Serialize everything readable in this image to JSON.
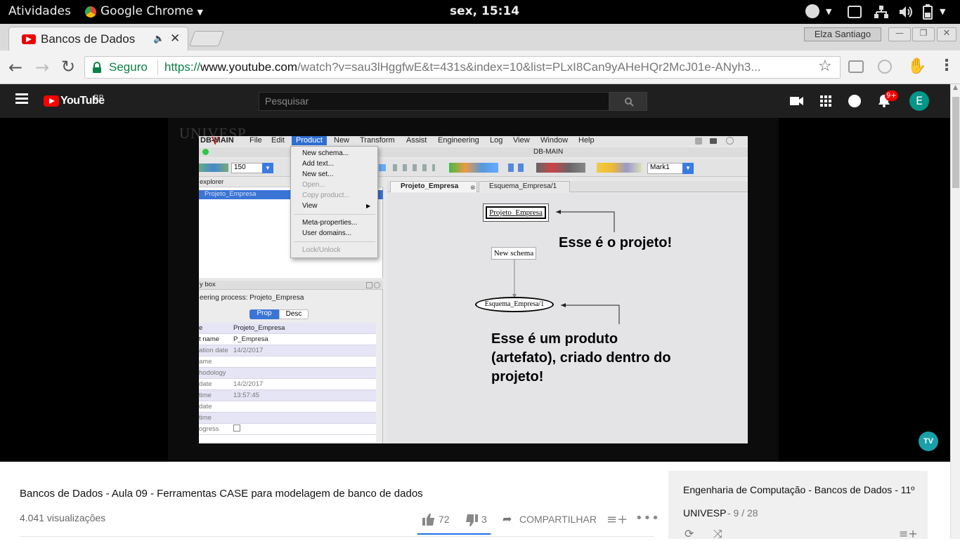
{
  "gnome": {
    "activities": "Atividades",
    "app_name": "Google Chrome",
    "clock": "sex, 15:14"
  },
  "chrome": {
    "tab_title": "Bancos de Dados",
    "profile_name": "Elza Santiago",
    "secure_label": "Seguro",
    "url_scheme": "https://",
    "url_host": "www.youtube.com",
    "url_rest": "/watch?v=sau3lHggfwE&t=431s&index=10&list=PLxI8Can9yAHeHQr2McJ01e-ANyh3..."
  },
  "youtube": {
    "logo_text": "YouTube",
    "region": "BR",
    "search_placeholder": "Pesquisar",
    "notif_count": "9+",
    "avatar_letter": "E"
  },
  "slide": {
    "watermark": "UNIVESP",
    "menubar": [
      "DB-MAIN",
      "File",
      "Edit",
      "Product",
      "New",
      "Transform",
      "Assist",
      "Engineering",
      "Log",
      "View",
      "Window",
      "Help"
    ],
    "window_title": "DB-MAIN",
    "zoom": "150",
    "mark": "Mark1",
    "dropdown": [
      "New schema...",
      "Add text...",
      "New set...",
      "Open...",
      "Copy product...",
      "View",
      "Meta-properties...",
      "User domains...",
      "Lock/Unlock"
    ],
    "explorer_title": "explorer",
    "explorer_item": "Projeto_Empresa",
    "propbox_title": "y box",
    "propbox_process": "eering process: Projeto_Empresa",
    "prop_tab": "Prop",
    "desc_tab": "Desc",
    "props": [
      {
        "k": "e",
        "v": "Projeto_Empresa"
      },
      {
        "k": "t name",
        "v": "P_Empresa"
      },
      {
        "k": "ation date",
        "v": "14/2/2017"
      },
      {
        "k": "ame",
        "v": ""
      },
      {
        "k": "hodology",
        "v": ""
      },
      {
        "k": "date",
        "v": "14/2/2017"
      },
      {
        "k": "time",
        "v": "13:57:45"
      },
      {
        "k": "date",
        "v": ""
      },
      {
        "k": "time",
        "v": ""
      },
      {
        "k": "ogress",
        "v": ""
      }
    ],
    "doc_tab1": "Projeto_Empresa",
    "doc_tab2": "Esquema_Empresa/1",
    "canvas_project": "Projeto_Empresa",
    "canvas_process": "New schema",
    "canvas_product": "Esquema_Empresa/1",
    "callout1": "Esse é o projeto!",
    "callout2_l1": "Esse é um produto",
    "callout2_l2": "(artefato), criado dentro do",
    "callout2_l3": "projeto!",
    "tv_logo": "TV"
  },
  "video": {
    "title": "Bancos de Dados - Aula 09 - Ferramentas CASE para modelagem de banco de dados",
    "views": "4.041 visualizações",
    "likes": "72",
    "dislikes": "3",
    "share": "COMPARTILHAR"
  },
  "playlist": {
    "title": "Engenharia de Computação - Bancos de Dados - 11º",
    "channel": "UNIVESP",
    "position": "- 9 / 28"
  }
}
